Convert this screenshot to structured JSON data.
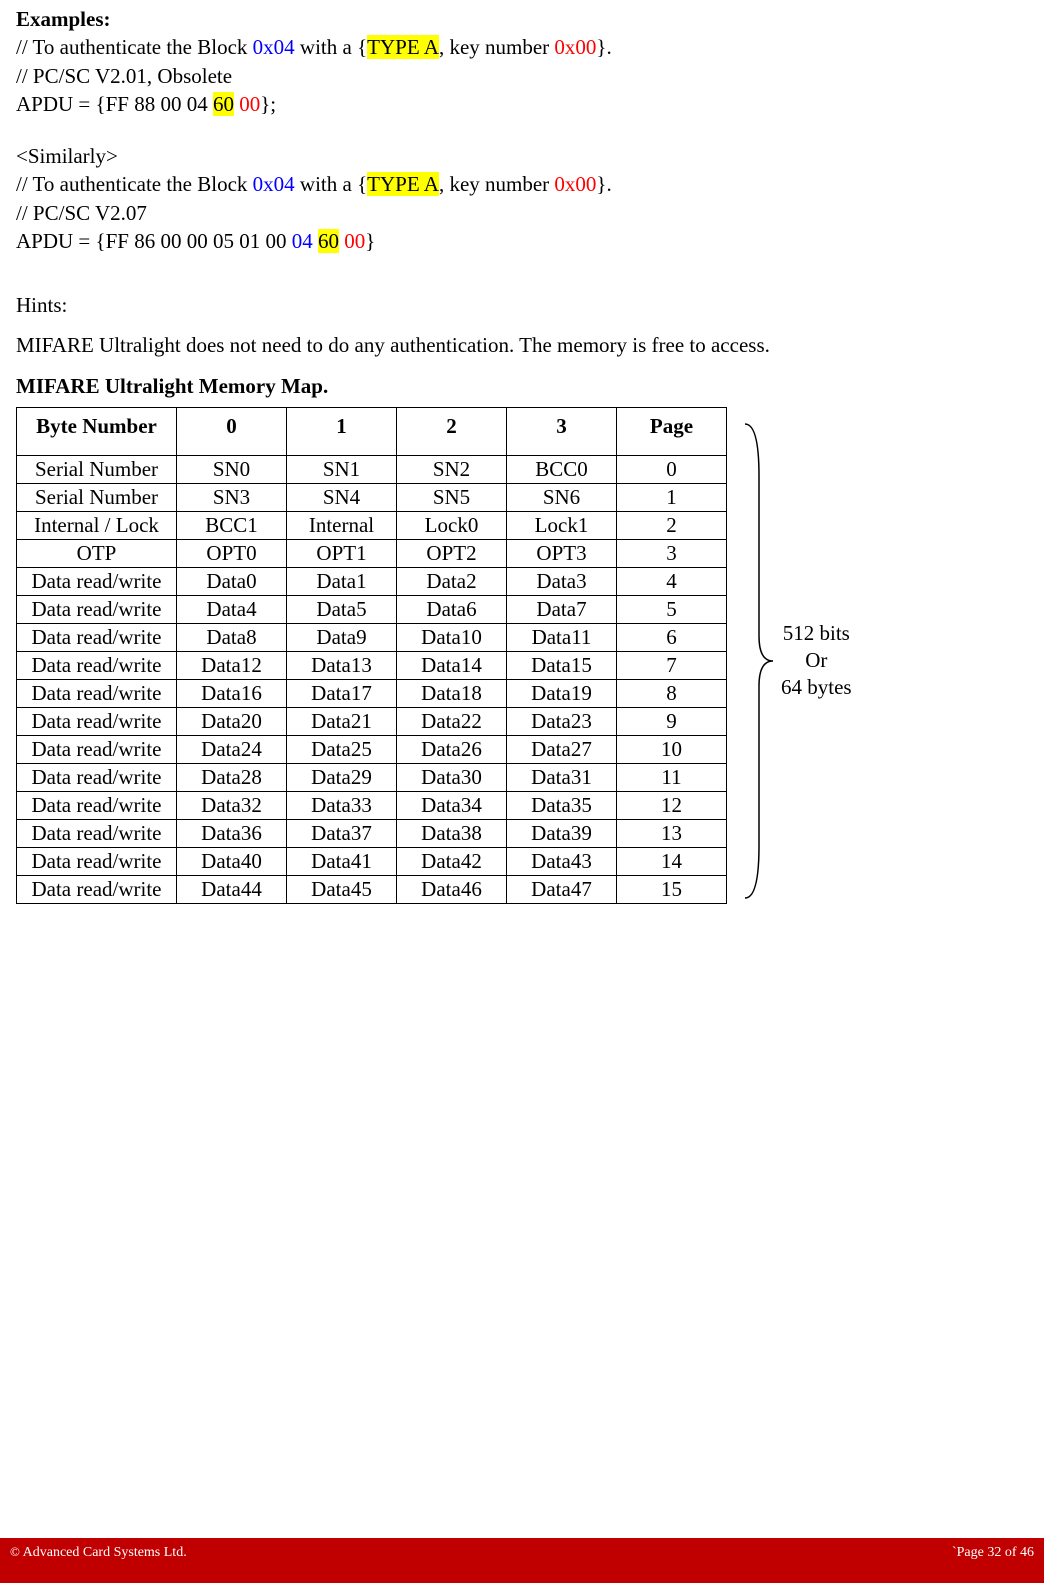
{
  "examples": {
    "heading": "Examples:",
    "line1_a": "// To authenticate the Block ",
    "line1_block": "0x04",
    "line1_b": " with a {",
    "line1_type": "TYPE A",
    "line1_c": ", key number ",
    "line1_keynum": "0x00",
    "line1_d": "}.",
    "line2": "// PC/SC V2.01, Obsolete",
    "apdu1_a": "APDU = {FF 88 00 04 ",
    "apdu1_60": "60",
    "apdu1_sp": " ",
    "apdu1_00": "00",
    "apdu1_b": "};",
    "similarly": "<Similarly>",
    "line4_a": "// To authenticate the Block ",
    "line4_block": "0x04",
    "line4_b": " with a {",
    "line4_type": "TYPE A",
    "line4_c": ", key number ",
    "line4_keynum": "0x00",
    "line4_d": "}.",
    "line5": "// PC/SC V2.07",
    "apdu2_a": "APDU = {FF 86 00 00 05 01 00 ",
    "apdu2_04": "04",
    "apdu2_sp": " ",
    "apdu2_60": "60",
    "apdu2_sp2": " ",
    "apdu2_00": "00",
    "apdu2_b": "}"
  },
  "hints": {
    "heading": "Hints:",
    "line": "MIFARE Ultralight does not need to do any authentication. The memory is free to access.",
    "map_heading": "MIFARE Ultralight Memory Map."
  },
  "table": {
    "headers": [
      "Byte Number",
      "0",
      "1",
      "2",
      "3",
      "Page"
    ],
    "rows": [
      [
        "Serial Number",
        "SN0",
        "SN1",
        "SN2",
        "BCC0",
        "0"
      ],
      [
        "Serial Number",
        "SN3",
        "SN4",
        "SN5",
        "SN6",
        "1"
      ],
      [
        "Internal / Lock",
        "BCC1",
        "Internal",
        "Lock0",
        "Lock1",
        "2"
      ],
      [
        "OTP",
        "OPT0",
        "OPT1",
        "OPT2",
        "OPT3",
        "3"
      ],
      [
        "Data read/write",
        "Data0",
        "Data1",
        "Data2",
        "Data3",
        "4"
      ],
      [
        "Data read/write",
        "Data4",
        "Data5",
        "Data6",
        "Data7",
        "5"
      ],
      [
        "Data read/write",
        "Data8",
        "Data9",
        "Data10",
        "Data11",
        "6"
      ],
      [
        "Data read/write",
        "Data12",
        "Data13",
        "Data14",
        "Data15",
        "7"
      ],
      [
        "Data read/write",
        "Data16",
        "Data17",
        "Data18",
        "Data19",
        "8"
      ],
      [
        "Data read/write",
        "Data20",
        "Data21",
        "Data22",
        "Data23",
        "9"
      ],
      [
        "Data read/write",
        "Data24",
        "Data25",
        "Data26",
        "Data27",
        "10"
      ],
      [
        "Data read/write",
        "Data28",
        "Data29",
        "Data30",
        "Data31",
        "11"
      ],
      [
        "Data read/write",
        "Data32",
        "Data33",
        "Data34",
        "Data35",
        "12"
      ],
      [
        "Data read/write",
        "Data36",
        "Data37",
        "Data38",
        "Data39",
        "13"
      ],
      [
        "Data read/write",
        "Data40",
        "Data41",
        "Data42",
        "Data43",
        "14"
      ],
      [
        "Data read/write",
        "Data44",
        "Data45",
        "Data46",
        "Data47",
        "15"
      ]
    ]
  },
  "brace": {
    "line1": "512 bits",
    "line2": "Or",
    "line3": "64 bytes"
  },
  "footer": {
    "left": " Advanced Card Systems Ltd.",
    "copyright": "©",
    "right": "`Page 32 of 46"
  }
}
